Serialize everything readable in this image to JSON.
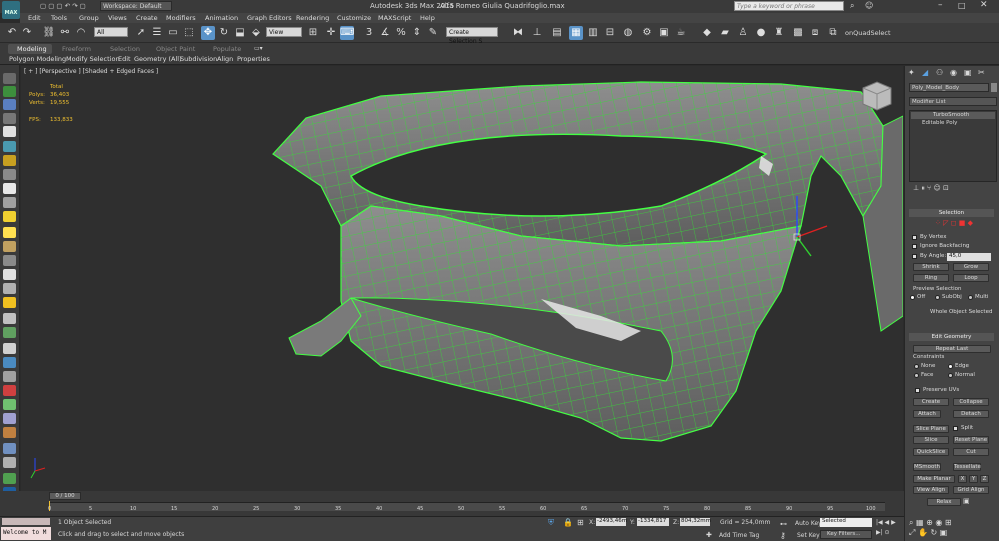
{
  "window": {
    "app": "Autodesk 3ds Max  2015",
    "file": "Alfa Romeo Giulia Quadrifoglio.max",
    "workspace": "Workspace: Default",
    "search_placeholder": "Type a keyword or phrase",
    "logo": "MAX"
  },
  "menu": [
    "Edit",
    "Tools",
    "Group",
    "Views",
    "Create",
    "Modifiers",
    "Animation",
    "Graph Editors",
    "Rendering",
    "Customize",
    "MAXScript",
    "Help"
  ],
  "toolbar": {
    "filter": "All",
    "coord": "View",
    "selection_set": "Create Selection S",
    "plugin": "onQuadSelect"
  },
  "ribbon": {
    "tabs": [
      "Modeling",
      "Freeform",
      "Selection",
      "Object Paint",
      "Populate"
    ],
    "subtabs": [
      "Polygon Modeling",
      "Modify Selection",
      "Edit",
      "Geometry (All)",
      "Subdivision",
      "Align",
      "Properties"
    ]
  },
  "viewport": {
    "label": "[ + ] [Perspective ] [Shaded + Edged Faces ]",
    "stats": {
      "total_label": "Total",
      "polys_label": "Polys:",
      "polys": "36,403",
      "verts_label": "Verts:",
      "verts": "19,555",
      "fps_label": "FPS:",
      "fps": "133,833"
    }
  },
  "panel": {
    "object_name": "Poly_Model_Body",
    "modifier_list": "Modifier List",
    "stack": [
      "TurboSmooth",
      "Editable Poly"
    ],
    "selection": {
      "title": "Selection",
      "by_vertex": "By Vertex",
      "ignore_backfacing": "Ignore Backfacing",
      "by_angle": "By Angle:",
      "angle": "45,0",
      "shrink": "Shrink",
      "grow": "Grow",
      "ring": "Ring",
      "loop": "Loop",
      "preview": "Preview Selection",
      "off": "Off",
      "subobj": "SubObj",
      "multi": "Multi",
      "status": "Whole Object Selected"
    },
    "edit_geometry": {
      "title": "Edit Geometry",
      "repeat_last": "Repeat Last",
      "constraints": "Constraints",
      "none": "None",
      "edge": "Edge",
      "face": "Face",
      "normal": "Normal",
      "preserve_uvs": "Preserve UVs",
      "create": "Create",
      "collapse": "Collapse",
      "attach": "Attach",
      "detach": "Detach",
      "slice_plane": "Slice Plane",
      "split": "Split",
      "slice": "Slice",
      "reset_plane": "Reset Plane",
      "quickslice": "QuickSlice",
      "cut": "Cut",
      "msmooth": "MSmooth",
      "tessellate": "Tessellate",
      "make_planar": "Make Planar",
      "x": "X",
      "y": "Y",
      "z": "Z",
      "view_align": "View Align",
      "grid_align": "Grid Align",
      "relax": "Relax"
    }
  },
  "timeline": {
    "frame": "0 / 100",
    "ticks": [
      "0",
      "5",
      "10",
      "15",
      "20",
      "25",
      "30",
      "35",
      "40",
      "45",
      "50",
      "55",
      "60",
      "65",
      "70",
      "75",
      "80",
      "85",
      "90",
      "95",
      "100"
    ]
  },
  "status": {
    "maxscript": "Welcome to M",
    "objects": "1 Object Selected",
    "prompt": "Click and drag to select and move objects",
    "x_label": "X:",
    "x": "-2493,46m",
    "y_label": "Y:",
    "y": "-1334,817",
    "z_label": "Z:",
    "z": "804,32mm",
    "grid": "Grid = 254,0mm",
    "add_time_tag": "Add Time Tag",
    "auto_key": "Auto Key",
    "selected": "Selected",
    "set_key": "Set Key",
    "key_filters": "Key Filters..."
  }
}
